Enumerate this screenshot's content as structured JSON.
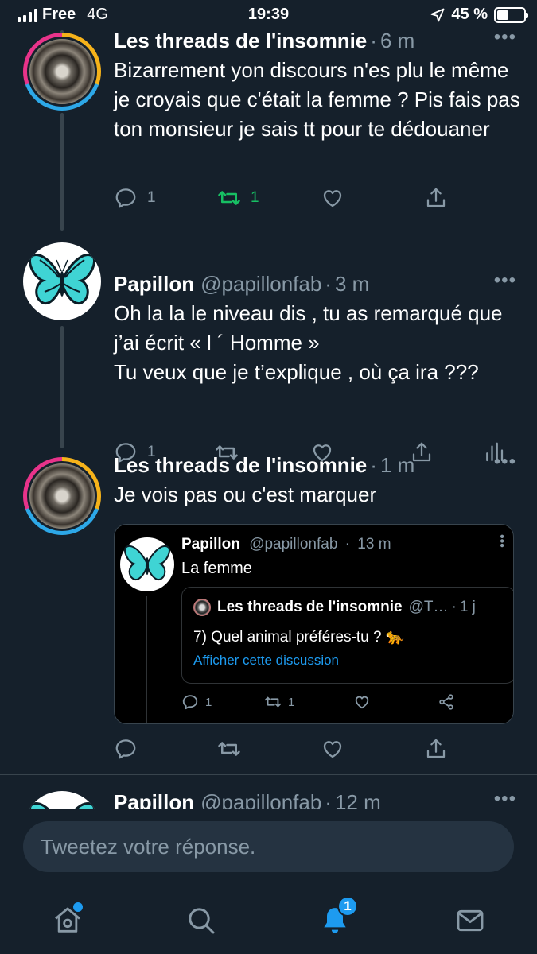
{
  "status_bar": {
    "carrier": "Free",
    "network": "4G",
    "time": "19:39",
    "battery": "45 %",
    "battery_level": 0.45
  },
  "tweets": [
    {
      "name": "Les threads de l'insomnie",
      "time": "6 m",
      "text": "Bizarrement yon discours n'es plu le même je croyais que c'était la femme ? Pis fais pas ton monsieur je sais tt pour te dédouaner",
      "reply_count": "1",
      "retweet_count": "1"
    },
    {
      "name": "Papillon",
      "handle": "@papillonfab",
      "time": "3 m",
      "text": "Oh la la le niveau dis , tu as remarqué que j’ai écrit «  l ´ Homme »\nTu veux que je t’explique , où ça ira ???",
      "reply_count": "1"
    },
    {
      "name": "Les threads de l'insomnie",
      "time": "1 m",
      "text": "Je vois pas ou c'est marquer",
      "quote": {
        "name": "Papillon",
        "handle": "@papillonfab",
        "time": "13 m",
        "text": "La femme",
        "inner": {
          "name": "Les threads de l'insomnie",
          "handle": "@T…",
          "time": "1 j",
          "text": "7) Quel animal préféres-tu ? 🐆",
          "link": "Afficher cette discussion"
        },
        "reply_count": "1",
        "retweet_count": "1"
      }
    },
    {
      "name": "Papillon",
      "handle": "@papillonfab",
      "time": "12 m"
    }
  ],
  "reply_bar": {
    "placeholder": "Tweetez votre réponse."
  },
  "tab_bar": {
    "notifications_badge": "1"
  },
  "colors": {
    "background": "#15202b",
    "secondary_text": "#8899a6",
    "accent": "#1d9bf0",
    "retweet_active": "#17bf63"
  }
}
